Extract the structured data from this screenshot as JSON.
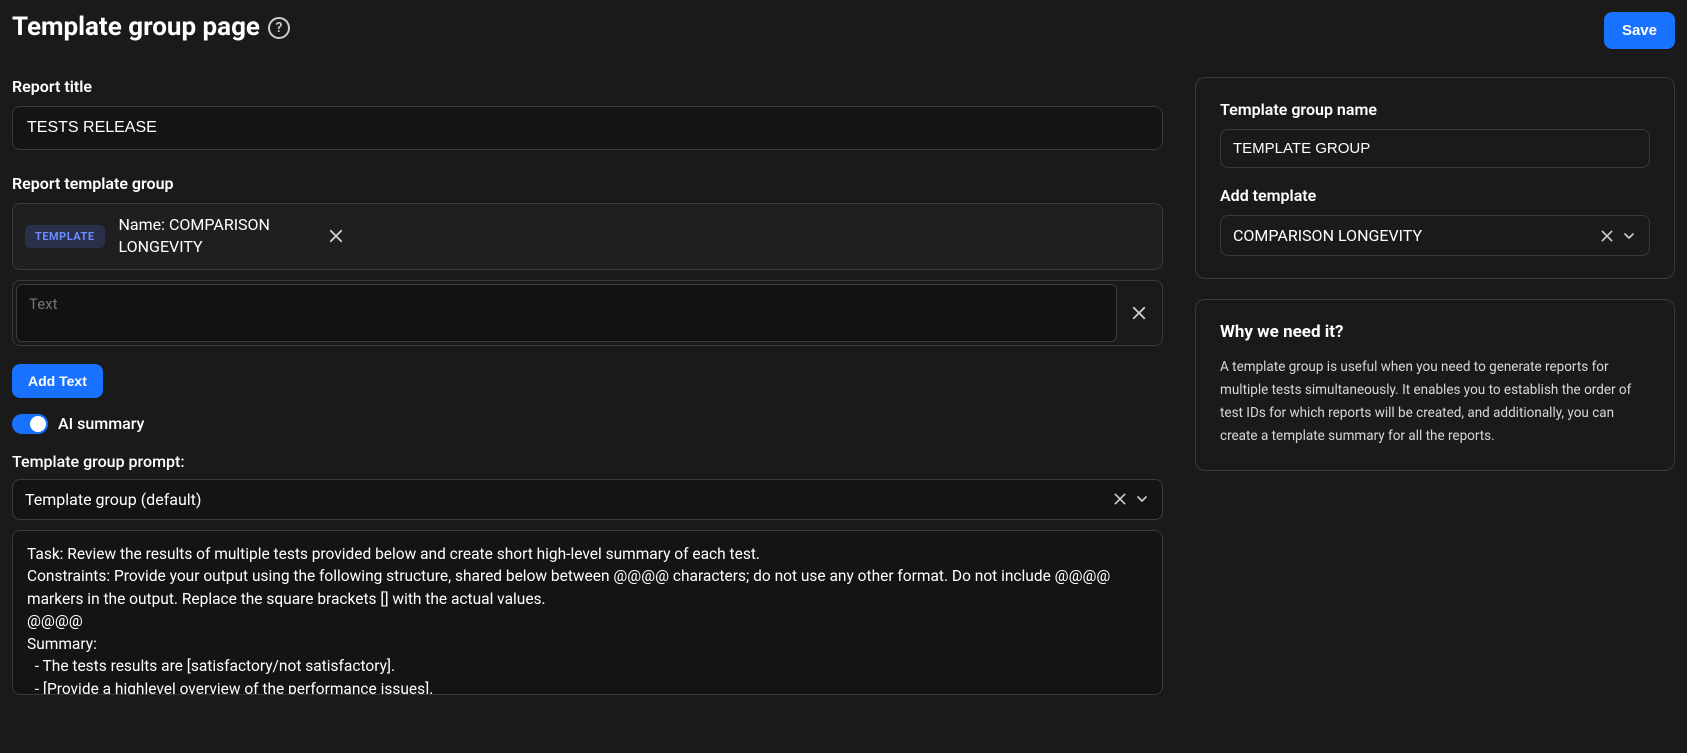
{
  "header": {
    "title": "Template group page",
    "save_label": "Save"
  },
  "report_title": {
    "label": "Report title",
    "value": "TESTS RELEASE"
  },
  "report_template_group": {
    "label": "Report template group",
    "badge": "TEMPLATE",
    "template_name": "Name: COMPARISON LONGEVITY",
    "text_placeholder": "Text",
    "add_text_label": "Add Text"
  },
  "ai_summary": {
    "label": "AI summary",
    "enabled": true
  },
  "prompt": {
    "label": "Template group prompt:",
    "selected": "Template group (default)",
    "body": "Task: Review the results of multiple tests provided below and create short high-level summary of each test.\nConstraints: Provide your output using the following structure, shared below between @@@@ characters; do not use any other format. Do not include @@@@ markers in the output. Replace the square brackets [] with the actual values.\n@@@@\nSummary:\n  - The tests results are [satisfactory/not satisfactory].\n  - [Provide a highlevel overview of the performance issues]."
  },
  "sidebar": {
    "group_name_label": "Template group name",
    "group_name_value": "TEMPLATE GROUP",
    "add_template_label": "Add template",
    "add_template_value": "COMPARISON LONGEVITY",
    "why_title": "Why we need it?",
    "why_body": "A template group is useful when you need to generate reports for multiple tests simultaneously. It enables you to establish the order of test IDs for which reports will be created, and additionally, you can create a template summary for all the reports."
  }
}
